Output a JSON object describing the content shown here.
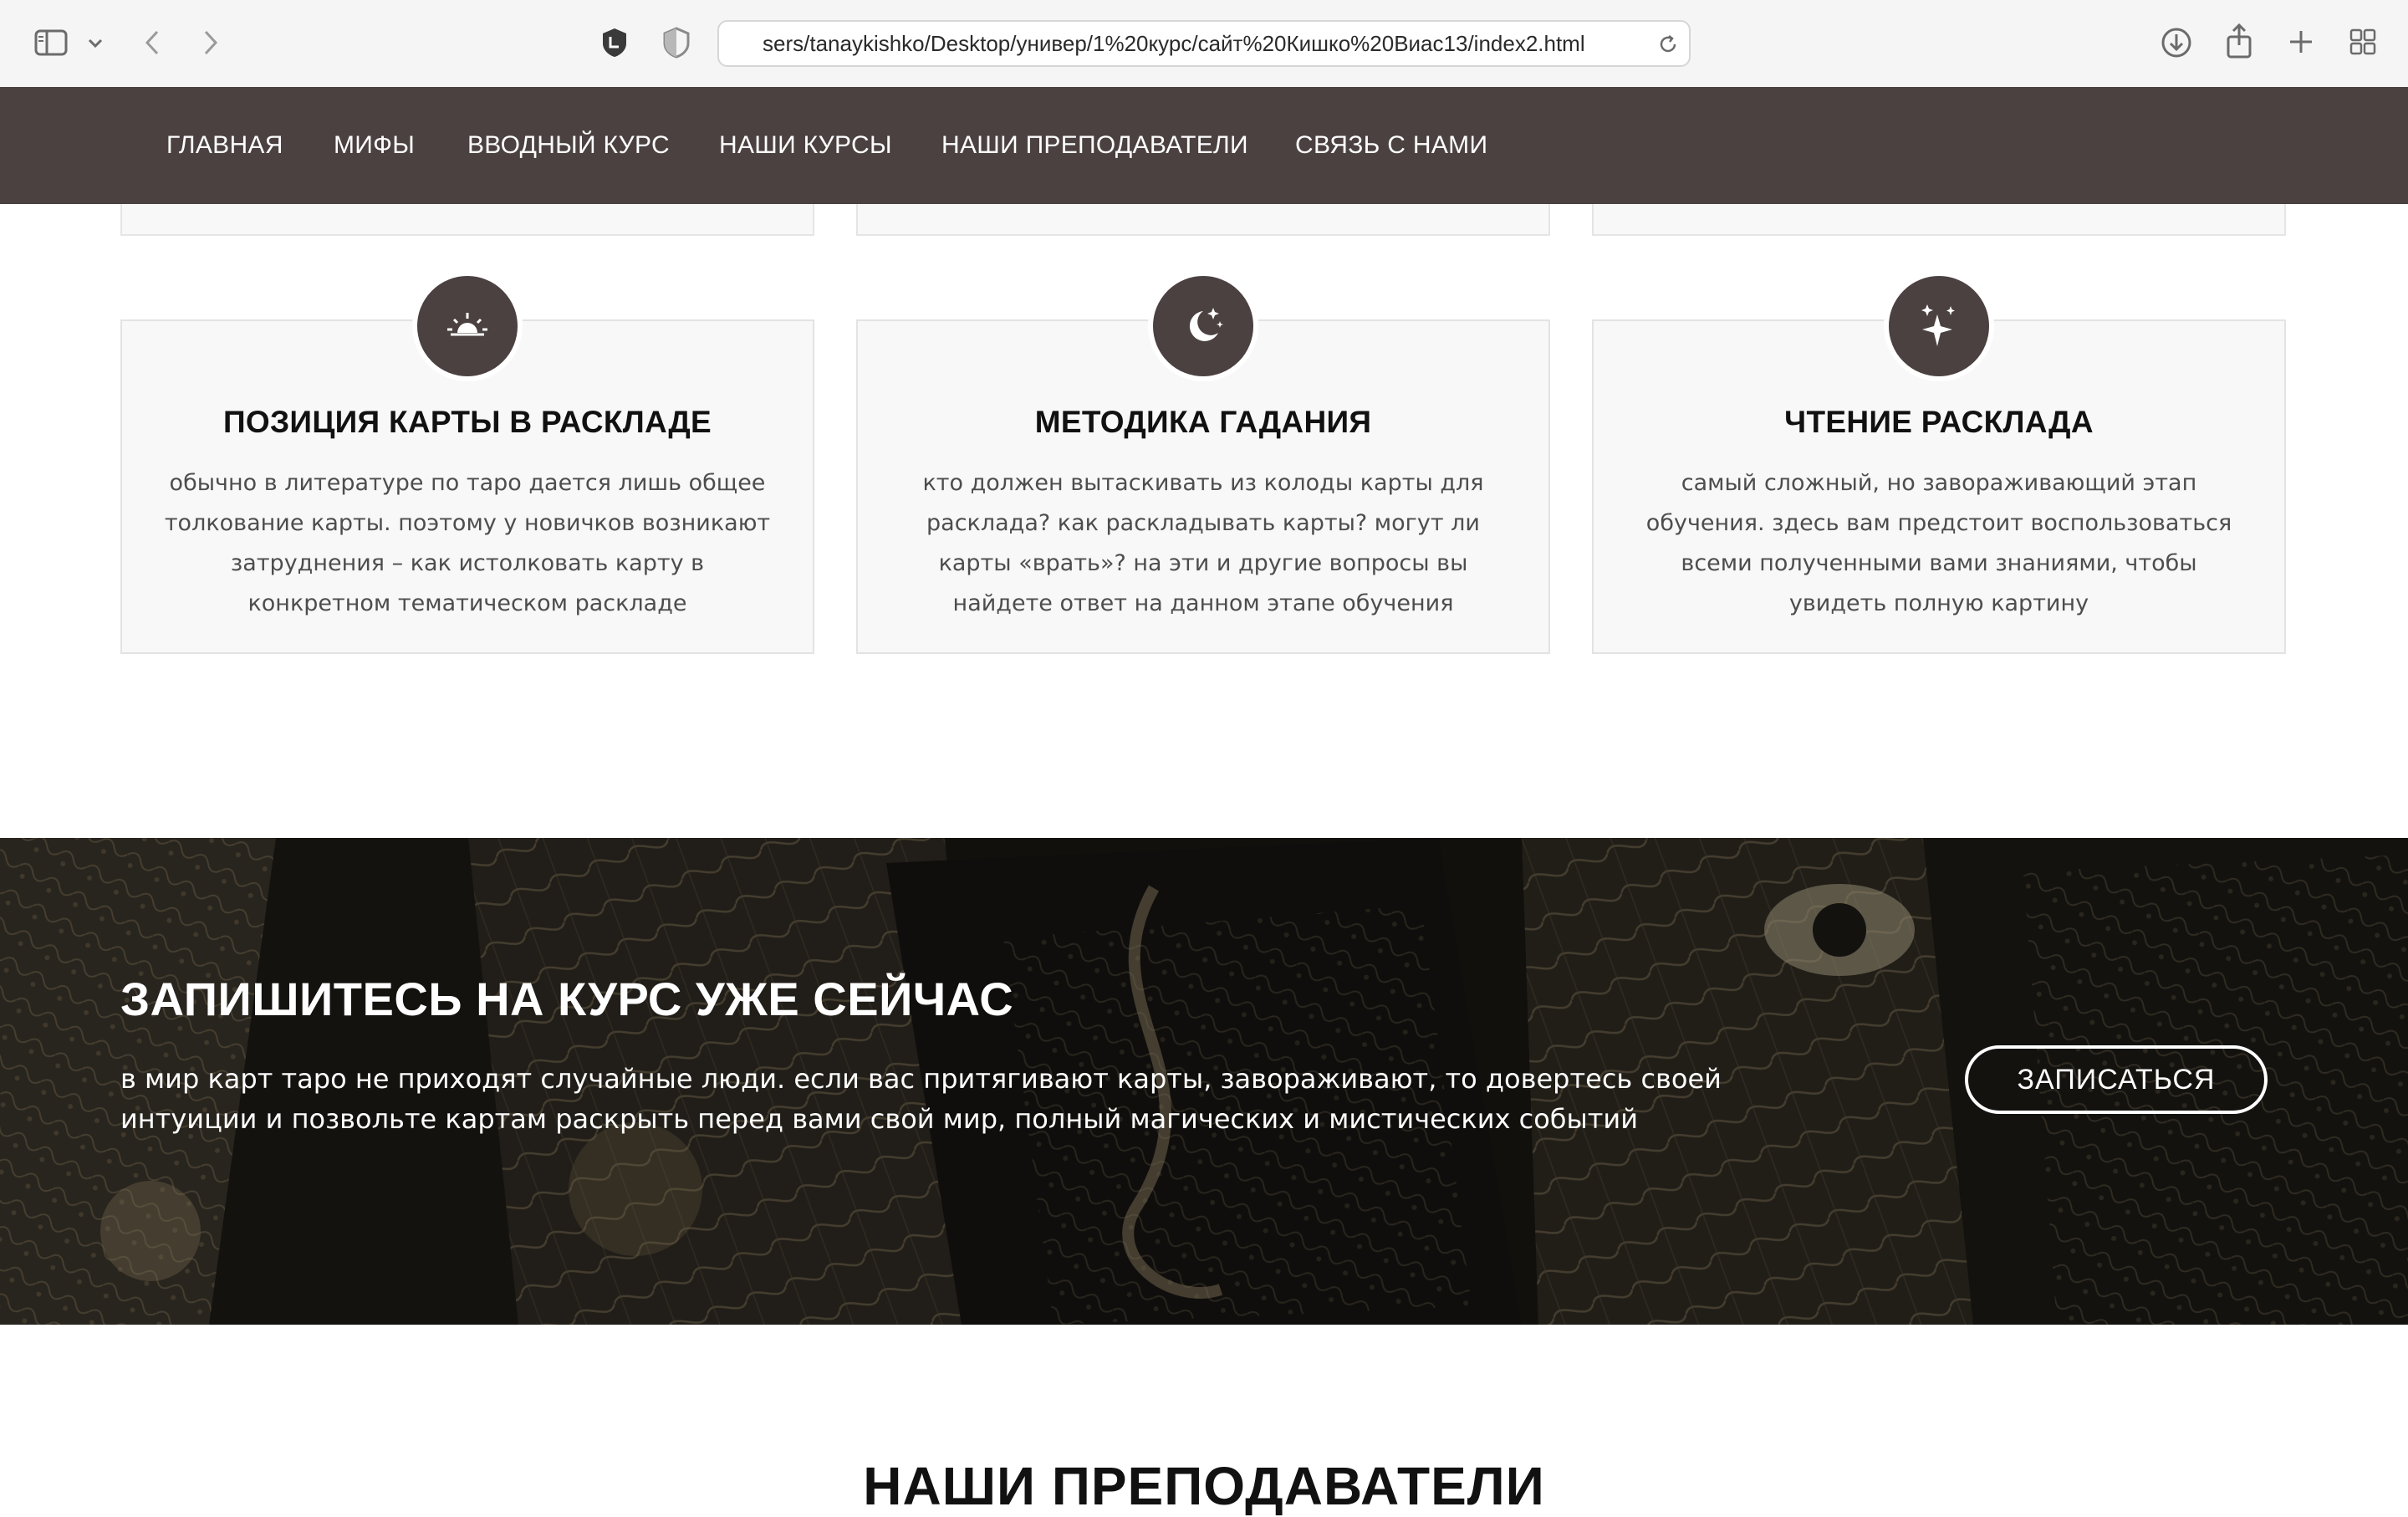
{
  "browser": {
    "url": "sers/tanaykishko/Desktop/универ/1%20курс/сайт%20Кишко%20Виас13/index2.html"
  },
  "nav": {
    "items": [
      "ГЛАВНАЯ",
      "МИФЫ",
      "ВВОДНЫЙ КУРС",
      "НАШИ КУРСЫ",
      "НАШИ ПРЕПОДАВАТЕЛИ",
      "СВЯЗЬ С НАМИ"
    ]
  },
  "features": [
    {
      "icon": "sunrise-icon",
      "title": "ПОЗИЦИЯ КАРТЫ В РАСКЛАДЕ",
      "text": "обычно в литературе по таро дается лишь общее толкование карты. поэтому у новичков возникают затруднения – как истолковать карту в конкретном тематическом раскладе"
    },
    {
      "icon": "moon-stars-icon",
      "title": "МЕТОДИКА ГАДАНИЯ",
      "text": "кто должен вытаскивать из колоды карты для расклада? как раскладывать карты? могут ли карты «врать»? на эти и другие вопросы вы найдете ответ на данном этапе обучения"
    },
    {
      "icon": "sparkles-icon",
      "title": "ЧТЕНИЕ РАСКЛАДА",
      "text": "самый сложный, но завораживающий этап обучения. здесь вам предстоит воспользоваться всеми полученными вами знаниями, чтобы увидеть полную картину"
    }
  ],
  "banner": {
    "title": "ЗАПИШИТЕСЬ НА КУРС УЖЕ СЕЙЧАС",
    "text": "в мир карт таро не приходят случайные люди. если вас притягивают карты, завораживают, то довертесь своей интуиции и позвольте картам раскрыть перед вами свой мир, полный магических и мистических событий",
    "button": "ЗАПИСАТЬСЯ"
  },
  "teachers": {
    "title": "НАШИ ПРЕПОДАВАТЕЛИ"
  },
  "colors": {
    "nav_bg": "#4a4140",
    "icon_bg": "#4a4140",
    "card_bg": "#f8f8f8"
  }
}
